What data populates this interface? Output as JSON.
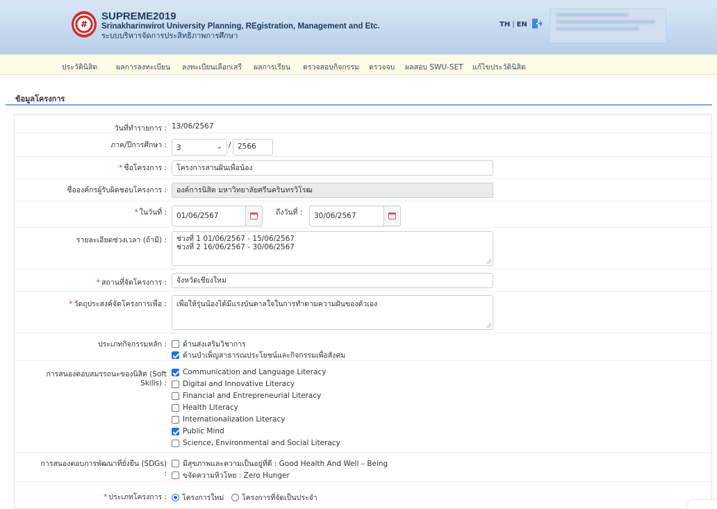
{
  "header": {
    "logo_text": "#",
    "app_name": "SUPREME2019",
    "subtitle_en": "Srinakharinwirot University Planning, REgistration, Management and Etc.",
    "subtitle_th": "ระบบบริหารจัดการประสิทธิภาพการศึกษา",
    "lang_th": "TH",
    "lang_sep": "|",
    "lang_en": "EN"
  },
  "menu": [
    "ประวัตินิสิต",
    "ผลการลงทะเบียน",
    "ลงทะเบียนเลือกเสรี",
    "ผลการเรียน",
    "ตรวจสอบกิจกรรม",
    "ตรวจจบ",
    "ผลสอบ SWU-SET",
    "แก้ไขประวัตินิสิต"
  ],
  "section_title": "ข้อมูลโครงการ",
  "form": {
    "required_mark": "*",
    "date_label": "วันที่ทำรายการ :",
    "date_value": "13/06/2567",
    "term_label": "ภาค/ปีการศึกษา :",
    "term_value": "3",
    "term_sep": "/",
    "year_value": "2566",
    "project_label": "ชื่อโครงการ :",
    "project_value": "โครงการสานฝันเพื่อน้อง",
    "org_label": "ชื่อองค์กรผู้รับผิดชอบโครงการ :",
    "org_value": "องค์การนิสิต มหาวิทยาลัยศรีนครินทรวิโรฒ",
    "from_label": "ในวันที่ :",
    "from_value": "01/06/2567",
    "to_label": "ถึงวันที่ :",
    "to_value": "30/06/2567",
    "detail_label": "รายละเอียดช่วงเวลา (ถ้ามี) :",
    "detail_line1": "ช่วงที่ 1 01/06/2567 - 15/06/2567",
    "detail_line2": "ช่วงที่ 2 16/06/2567 - 30/06/2567",
    "place_label": "สถานที่จัดโครงการ :",
    "place_value": "จังหวัดเชียงใหม่",
    "purpose_label": "วัตถุประสงค์จัดโครงการเพื่อ :",
    "purpose_value": "เพื่อให้รุ่นน้องได้มีแรงบันดาลใจในการทำตามความฝันของตัวเอง",
    "type_label": "ประเภทกิจกรรมหลัก :",
    "type_options": [
      {
        "label": "ด้านส่งเสริมวิชาการ",
        "checked": false
      },
      {
        "label": "ด้านบำเพ็ญสาธารณประโยชน์และกิจกรรมเพื่อสังคม",
        "checked": true
      }
    ],
    "soft_label1": "การสนองตอบสมรรถนะของนิสิต (Soft",
    "soft_label2": "Skills) :",
    "soft_options": [
      {
        "label": "Communication and Language Literacy",
        "checked": true
      },
      {
        "label": "Digital and Innovative Literacy",
        "checked": false
      },
      {
        "label": "Financial and Entrepreneurial Literacy",
        "checked": false
      },
      {
        "label": "Health Literacy",
        "checked": false
      },
      {
        "label": "Internationalization Literacy",
        "checked": false
      },
      {
        "label": "Public Mind",
        "checked": true
      },
      {
        "label": "Science, Environmental and Social Literacy",
        "checked": false
      }
    ],
    "sdg_label1": "การสนองตอบการพัฒนาที่ยั่งยืน (SDGs)",
    "sdg_label2": ":",
    "sdg_options": [
      {
        "label": "มีสุขภาพและความเป็นอยู่ที่ดี : Good Health And Well – Being",
        "checked": false
      },
      {
        "label": "ขจัดความหิวโหย : Zero Hunger",
        "checked": false
      }
    ],
    "ptype_label": "ประเภทโครงการ :",
    "ptype_options": [
      {
        "label": "โครงการใหม่",
        "checked": true
      },
      {
        "label": "โครงการที่จัดเป็นประจำ",
        "checked": false
      }
    ]
  }
}
